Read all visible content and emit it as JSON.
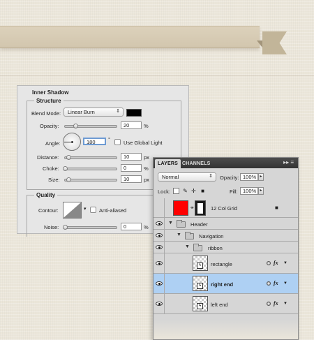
{
  "inner_shadow": {
    "title": "Inner Shadow",
    "structure": {
      "title": "Structure",
      "blend_mode_label": "Blend Mode:",
      "blend_mode_value": "Linear Burn",
      "opacity_label": "Opacity:",
      "opacity_value": "20",
      "opacity_unit": "%",
      "opacity_level": 0.2,
      "angle_label": "Angle:",
      "angle_value": "180",
      "angle_unit": "°",
      "use_global_light_label": "Use Global Light",
      "distance_label": "Distance:",
      "distance_value": "10",
      "distance_unit": "px",
      "choke_label": "Choke:",
      "choke_value": "0",
      "choke_unit": "%",
      "size_label": "Size:",
      "size_value": "10",
      "size_unit": "px"
    },
    "quality": {
      "title": "Quality",
      "contour_label": "Contour:",
      "anti_aliased_label": "Anti-aliased",
      "noise_label": "Noise:",
      "noise_value": "0",
      "noise_unit": "%"
    },
    "colors": {
      "shadow_color": "#000000"
    }
  },
  "layers_panel": {
    "tabs": [
      "LAYERS",
      "CHANNELS"
    ],
    "menu_glyph": "▸▸ ≡",
    "blend_mode": "Normal",
    "opacity_label": "Opacity:",
    "opacity_value": "100%",
    "lock_label": "Lock:",
    "fill_label": "Fill:",
    "fill_value": "100%",
    "layers": [
      {
        "name": "12 Col Grid",
        "type": "shape"
      },
      {
        "name": "Header",
        "type": "group"
      },
      {
        "name": "Navigation",
        "type": "group"
      },
      {
        "name": "ribbon",
        "type": "group"
      },
      {
        "name": "rectangle",
        "type": "layer",
        "fx": "fx"
      },
      {
        "name": "right end",
        "type": "layer",
        "fx": "fx",
        "selected": true
      },
      {
        "name": "left end",
        "type": "layer",
        "fx": "fx"
      }
    ],
    "colors": {
      "selected_row": "#aed0f3",
      "grid_swatch": "#ff0000"
    }
  }
}
